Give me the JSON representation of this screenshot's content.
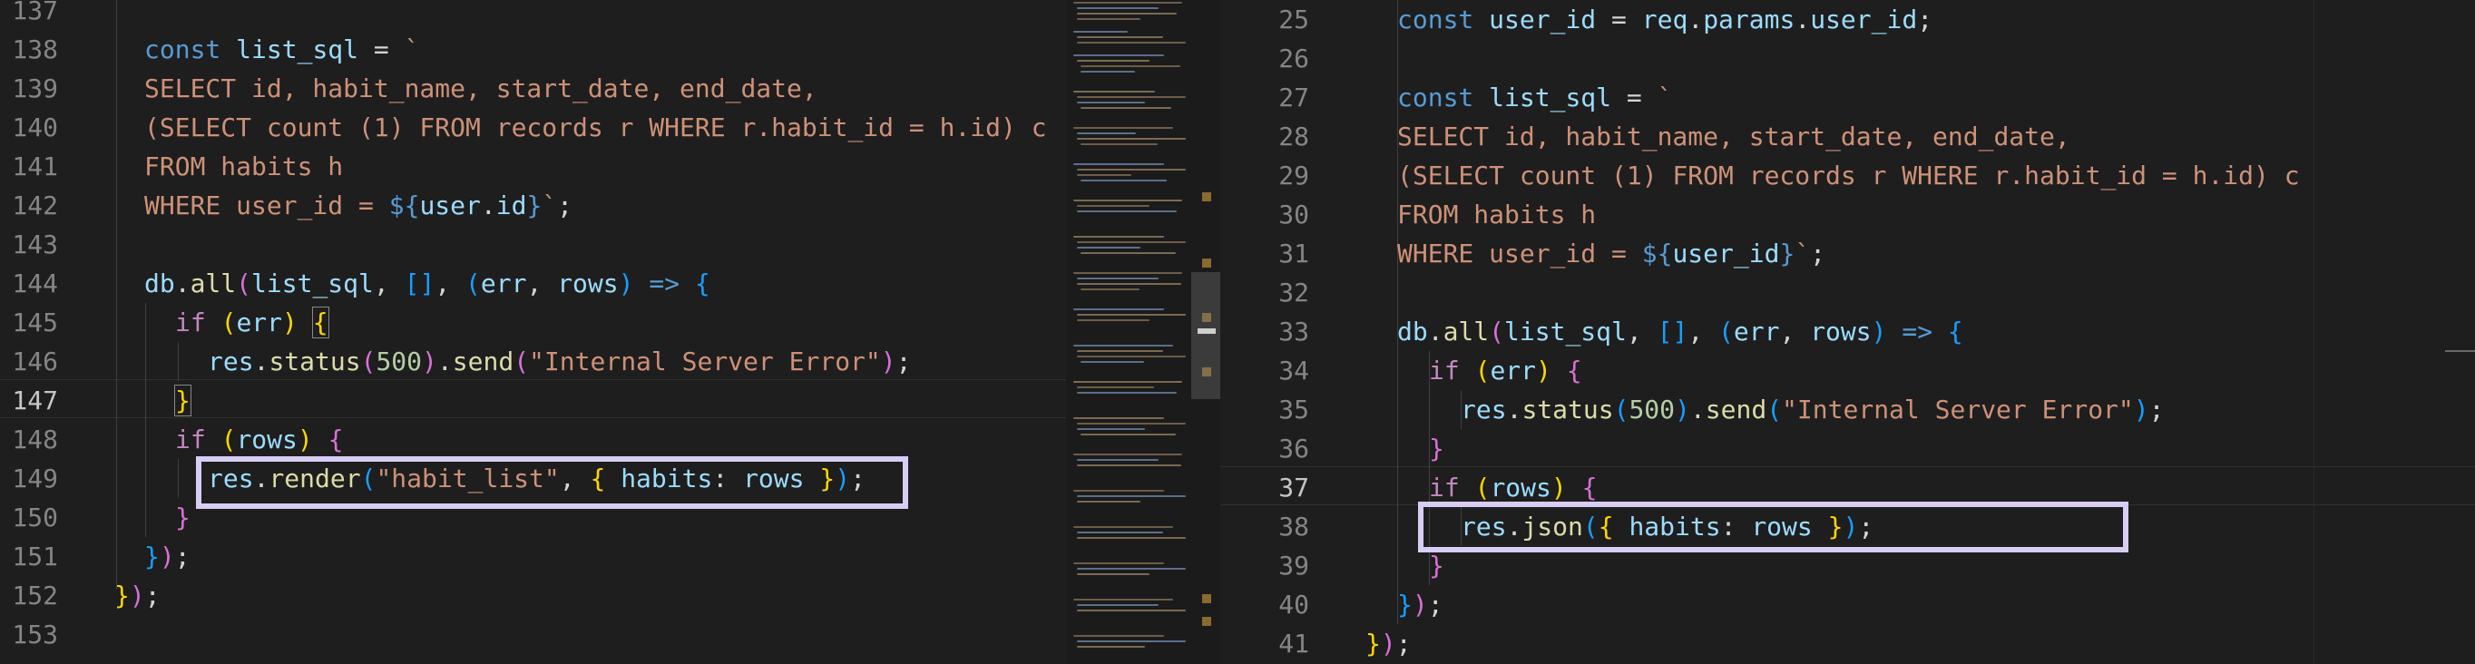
{
  "left_editor": {
    "line_numbers": [
      "137",
      "138",
      "139",
      "140",
      "141",
      "142",
      "143",
      "144",
      "145",
      "146",
      "147",
      "148",
      "149",
      "150",
      "151",
      "152",
      "153"
    ],
    "active_line": "147"
  },
  "right_editor": {
    "line_numbers": [
      "25",
      "26",
      "27",
      "28",
      "29",
      "30",
      "31",
      "32",
      "33",
      "34",
      "35",
      "36",
      "37",
      "38",
      "39",
      "40",
      "41"
    ],
    "active_line": "37"
  },
  "colors": {
    "background": "#1e1e1e",
    "highlight_box": "#d7cdf5",
    "keyword": "#569cd6",
    "string": "#ce9178",
    "function": "#dcdcaa"
  }
}
